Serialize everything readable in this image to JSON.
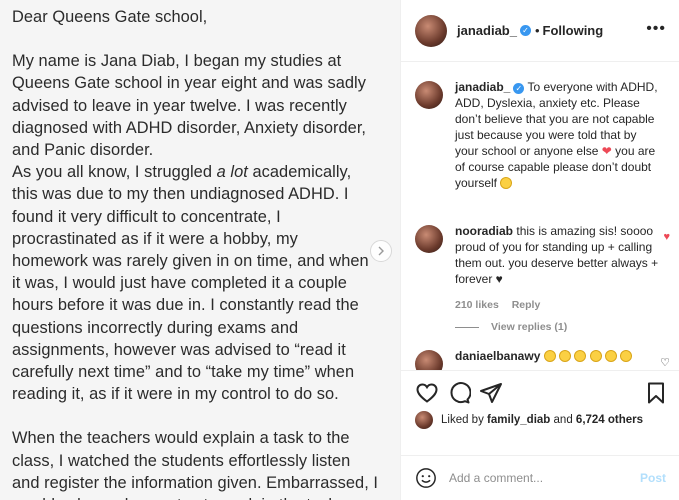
{
  "post": {
    "letter": {
      "salutation": "Dear Queens Gate school,",
      "para1": "My name is Jana Diab, I began my studies at\nQueens Gate school in year eight and was sadly\nadvised to leave in year twelve. I was recently\ndiagnosed with ADHD disorder, Anxiety disorder,\nand Panic disorder.",
      "para2_start": "As you all know, I struggled ",
      "para2_italic": "a lot",
      "para2_rest": " academically,\nthis was due to my then undiagnosed ADHD. I\nfound it very difficult to concentrate, I\nprocrastinated as if it were a hobby, my\nhomework was rarely given in on time, and when\nit was, I would just have completed it a couple\nhours before it was due in. I constantly read the\nquestions incorrectly during exams and\nassignments, however was advised to “read it\ncarefully next time” and to “take my time” when\nreading it, as if it were in my control to do so.",
      "para3": "When the teachers would explain a task to the\nclass, I watched the students effortlessly listen\nand register the information given. Embarrassed, I\nwould ask my classmates to explain the task"
    },
    "next_icon": "chevron-right-icon"
  },
  "header": {
    "username": "janadiab_",
    "separator": "•",
    "follow_status": "Following",
    "more_icon": "•••"
  },
  "caption": {
    "username": "janadiab_",
    "text_before_heart": "To everyone with ADHD, ADD, Dyslexia, anxiety etc. Please don’t believe that you are not capable just because you were told that by your school or anyone else ",
    "heart": "❤",
    "text_after_heart": " you are of course capable please don’t doubt yourself"
  },
  "comments": [
    {
      "username": "nooradiab",
      "text": "this is amazing sis! soooo proud of you for standing up + calling them out. you deserve better always + forever ♥",
      "likes": "210 likes",
      "reply_label": "Reply",
      "liked": true
    },
    {
      "username": "daniaelbanawy",
      "text": "",
      "emoji_count": 6
    }
  ],
  "view_replies": "View replies (1)",
  "liked_by": {
    "prefix": "Liked by ",
    "user": "family_diab",
    "middle": " and ",
    "count": "6,724 others"
  },
  "add_comment": {
    "placeholder": "Add a comment...",
    "post_label": "Post"
  },
  "colors": {
    "accent_blue": "#3897f0",
    "heart_red": "#ed4956",
    "muted": "#8e8e8e",
    "post_disabled": "#b2dffc"
  }
}
